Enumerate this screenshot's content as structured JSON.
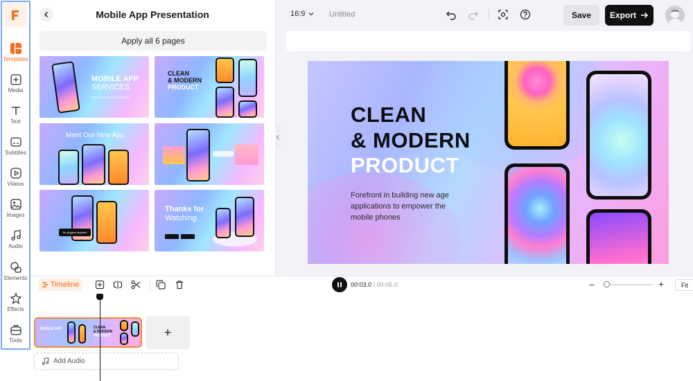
{
  "rail": {
    "items": [
      {
        "label": "Templates",
        "icon": "templates-icon",
        "active": true
      },
      {
        "label": "Media",
        "icon": "media-icon"
      },
      {
        "label": "Text",
        "icon": "text-icon"
      },
      {
        "label": "Subtitles",
        "icon": "subtitles-icon"
      },
      {
        "label": "Videos",
        "icon": "videos-icon"
      },
      {
        "label": "Images",
        "icon": "images-icon"
      },
      {
        "label": "Audio",
        "icon": "audio-icon"
      },
      {
        "label": "Elements",
        "icon": "elements-icon"
      },
      {
        "label": "Effects",
        "icon": "effects-icon"
      },
      {
        "label": "Tools",
        "icon": "tools-icon"
      }
    ]
  },
  "panel": {
    "title": "Mobile App Presentation",
    "apply_label": "Apply all 6 pages",
    "thumbnails": [
      {
        "line1": "MOBILE APP",
        "line2": "SERVICES",
        "line3": "WE DEVELOPED CODE APPS"
      },
      {
        "line1": "CLEAN",
        "line2": "& MODERN",
        "line3": "PRODUCT"
      },
      {
        "line1": "Meet Our New App"
      },
      {
        "line1": ""
      },
      {
        "line1": "No plugins required"
      },
      {
        "line1": "Thanks for",
        "line2": "Watching"
      }
    ]
  },
  "topbar": {
    "ratio": "16:9",
    "doc_title": "Untitled",
    "save_label": "Save",
    "export_label": "Export"
  },
  "slide": {
    "h1": "CLEAN",
    "h2": "& MODERN",
    "h3": "PRODUCT",
    "body": "Forefront in building new age applications to empower the mobile phones"
  },
  "timeline": {
    "label": "Timeline",
    "current": "00:03.0",
    "duration": "00:05.0",
    "fit_label": "Fit",
    "add_audio": "Add Audio",
    "add_clip": "+",
    "zoom_minus": "−",
    "zoom_plus": "+",
    "clip_mini1": "MOBILE APP",
    "clip_mini2a": "CLEAN",
    "clip_mini2b": "& MODERN",
    "clip_mini2c": "PRODUCT"
  },
  "colors": {
    "accent": "#f26d21",
    "rail_border": "#7aa7f5"
  }
}
